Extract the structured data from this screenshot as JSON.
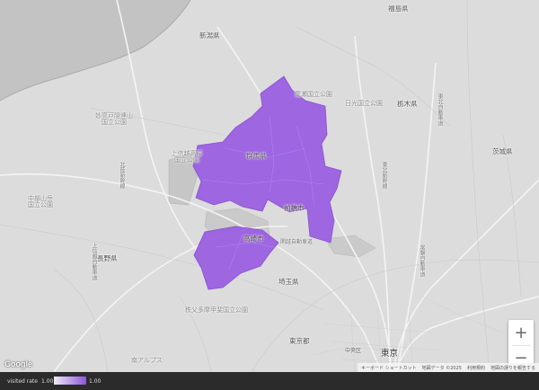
{
  "map_labels": {
    "fukushima": "福島県",
    "niigata": "新潟県",
    "oze": "尾瀬国立公園",
    "nikko": "日光国立公園",
    "tochigi": "栃木県",
    "myoko": "妙高戸隠連山国立公園",
    "joshinetsu": "上信越高原国立公園",
    "gunma": "群馬県",
    "ibaraki": "茨城県",
    "chubu": "中部山岳国立公園",
    "nagano": "長野県",
    "maebashi": "前橋市",
    "takasaki": "高崎市",
    "saitama": "埼玉県",
    "chichibu": "秩父多摩甲斐国立公園",
    "tokyo_pref": "東京都",
    "tokyo": "東京",
    "minami_alps": "南アルプス",
    "nakanoshima": "中央区",
    "route_hokuriku": "北陸新幹線",
    "route_tohoku": "東北新幹線",
    "route_kanetsu": "関越自動車道",
    "route_joshinetsu": "上信越自動車道",
    "route_tohoku_exp": "東北自動車道",
    "route_joban": "常磐自動車道"
  },
  "attribution": {
    "shortcuts": "キーボード ショートカット",
    "mapdata": "地図データ ©2025",
    "terms": "利用規約",
    "report": "地図の誤りを報告する"
  },
  "logo": "Google",
  "zoom": {
    "in": "+",
    "out": "−"
  },
  "legend": {
    "title": "visited rate",
    "min": "1.00",
    "max": "1.00"
  },
  "colors": {
    "region_fill": "#9a5fe0",
    "map_bg": "#dcdcdc",
    "legend_min": "#ececf6",
    "legend_max": "#8d55d6"
  }
}
